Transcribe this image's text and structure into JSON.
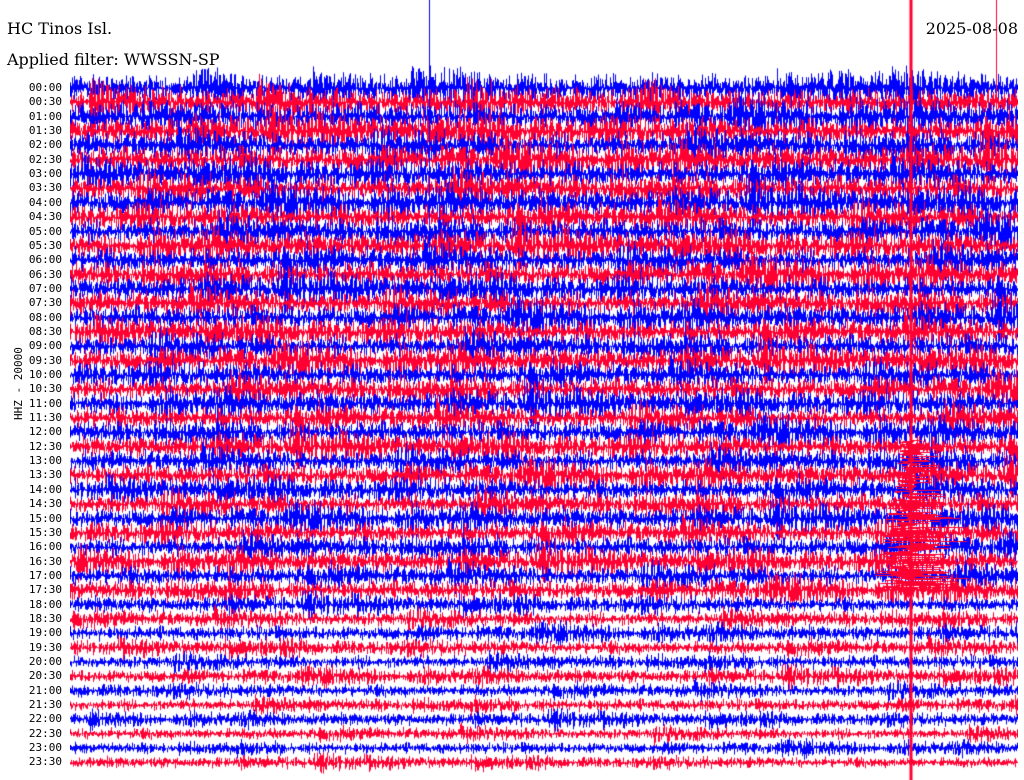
{
  "header": {
    "station": "HC Tinos Isl.",
    "date": "2025-08-08",
    "filter": "Applied filter: WWSSN-SP"
  },
  "channel_label": "HHZ - 20000",
  "time_labels": [
    "00:00",
    "00:30",
    "01:00",
    "01:30",
    "02:00",
    "02:30",
    "03:00",
    "03:30",
    "04:00",
    "04:30",
    "05:00",
    "05:30",
    "06:00",
    "06:30",
    "07:00",
    "07:30",
    "08:00",
    "08:30",
    "09:00",
    "09:30",
    "10:00",
    "10:30",
    "11:00",
    "11:30",
    "12:00",
    "12:30",
    "13:00",
    "13:30",
    "14:00",
    "14:30",
    "15:00",
    "15:30",
    "16:00",
    "16:30",
    "17:00",
    "17:30",
    "18:00",
    "18:30",
    "19:00",
    "19:30",
    "20:00",
    "20:30",
    "21:00",
    "21:30",
    "22:00",
    "22:30",
    "23:00",
    "23:30"
  ],
  "colors": {
    "trace_a": "#0000ff",
    "trace_b": "#ff0033",
    "background": "#ffffff",
    "text": "#000000"
  }
}
